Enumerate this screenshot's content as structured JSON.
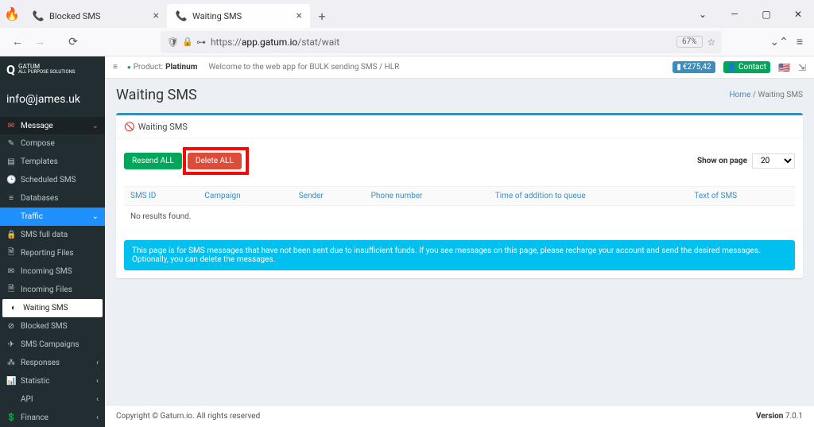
{
  "browser": {
    "tabs": [
      {
        "title": "Blocked SMS",
        "active": false
      },
      {
        "title": "Waiting SMS",
        "active": true
      }
    ],
    "url_prefix": "https://",
    "url_host": "app.gatum.io",
    "url_path": "/stat/wait",
    "zoom": "67%"
  },
  "logo": {
    "letter": "Q",
    "line1": "GATUM",
    "line2": "ALL PURPOSE SOLUTIONS"
  },
  "account_email": "info@james.uk",
  "sidebar": {
    "header": {
      "label": "Message"
    },
    "items": [
      {
        "label": "Compose",
        "icon": "✎"
      },
      {
        "label": "Templates",
        "icon": "▤"
      },
      {
        "label": "Scheduled SMS",
        "icon": "🕒"
      },
      {
        "label": "Databases",
        "icon": "≡"
      },
      {
        "label": "Traffic",
        "icon": "",
        "traffic": true
      },
      {
        "label": "SMS full data",
        "icon": "🔒"
      },
      {
        "label": "Reporting Files",
        "icon": "🗎"
      },
      {
        "label": "Incoming SMS",
        "icon": "✉"
      },
      {
        "label": "Incoming Files",
        "icon": "🗎"
      },
      {
        "label": "Waiting SMS",
        "icon": "◐",
        "active": true
      },
      {
        "label": "Blocked SMS",
        "icon": "⊘"
      },
      {
        "label": "SMS Campaigns",
        "icon": "✈"
      },
      {
        "label": "Responses",
        "icon": "⁂",
        "chev": true
      },
      {
        "label": "Statistic",
        "icon": "📊",
        "chev": true
      },
      {
        "label": "API",
        "icon": "</>",
        "chev": true
      },
      {
        "label": "Finance",
        "icon": "💲",
        "chev": true
      }
    ]
  },
  "topbar": {
    "product_label": "Product:",
    "product_name": "Platinum",
    "welcome": "Welcome to the web app for BULK sending SMS / HLR",
    "balance": "€275,42",
    "contact": "Contact"
  },
  "page": {
    "title": "Waiting SMS",
    "breadcrumb_home": "Home",
    "breadcrumb_sep": " / ",
    "breadcrumb_current": "Waiting SMS"
  },
  "panel": {
    "title": "Waiting SMS",
    "resend_btn": "Resend ALL",
    "delete_btn": "Delete ALL",
    "show_on_page_label": "Show on page",
    "page_size": "20",
    "columns": [
      "SMS ID",
      "Campaign",
      "Sender",
      "Phone number",
      "Time of addition to queue",
      "Text of SMS"
    ],
    "empty": "No results found.",
    "info": "This page is for SMS messages that have not been sent due to insufficient funds. If you see messages on this page, please recharge your account and send the desired messages. Optionally, you can delete the messages."
  },
  "footer": {
    "copyright": "Copyright © Gatum.io. All rights reserved",
    "version_label": "Version ",
    "version": "7.0.1"
  }
}
